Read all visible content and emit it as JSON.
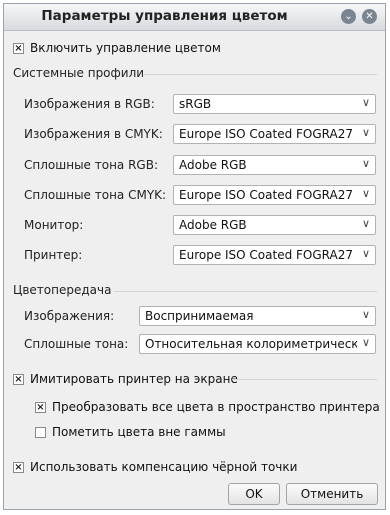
{
  "window": {
    "title": "Параметры управления цветом"
  },
  "enable_cm": {
    "checked": "×",
    "label": "Включить управление цветом"
  },
  "system_profiles": {
    "heading": "Системные профили",
    "rows": [
      {
        "label": "Изображения в RGB:",
        "value": "sRGB"
      },
      {
        "label": "Изображения в CMYK:",
        "value": "Europe ISO Coated FOGRA27"
      },
      {
        "label": "Сплошные тона RGB:",
        "value": "Adobe RGB"
      },
      {
        "label": "Сплошные тона CMYK:",
        "value": "Europe ISO Coated FOGRA27"
      },
      {
        "label": "Монитор:",
        "value": "Adobe RGB"
      },
      {
        "label": "Принтер:",
        "value": "Europe ISO Coated FOGRA27"
      }
    ]
  },
  "rendering": {
    "heading": "Цветопередача",
    "rows": [
      {
        "label": "Изображения:",
        "value": "Воспринимаемая"
      },
      {
        "label": "Сплошные тона:",
        "value": "Относительная колориметрическая"
      }
    ]
  },
  "simulate": {
    "checked": "×",
    "label": "Имитировать принтер на экране"
  },
  "convert": {
    "checked": "×",
    "label": "Преобразовать все цвета в пространство принтера"
  },
  "gamut": {
    "checked": "",
    "label": "Пометить цвета вне гаммы"
  },
  "bpc": {
    "checked": "×",
    "label": "Использовать компенсацию чёрной точки"
  },
  "buttons": {
    "ok": "OK",
    "cancel": "Отменить"
  },
  "icons": {
    "minimize": "chevron-down-icon",
    "close": "close-icon",
    "dropdown": "chevron-down-icon"
  }
}
